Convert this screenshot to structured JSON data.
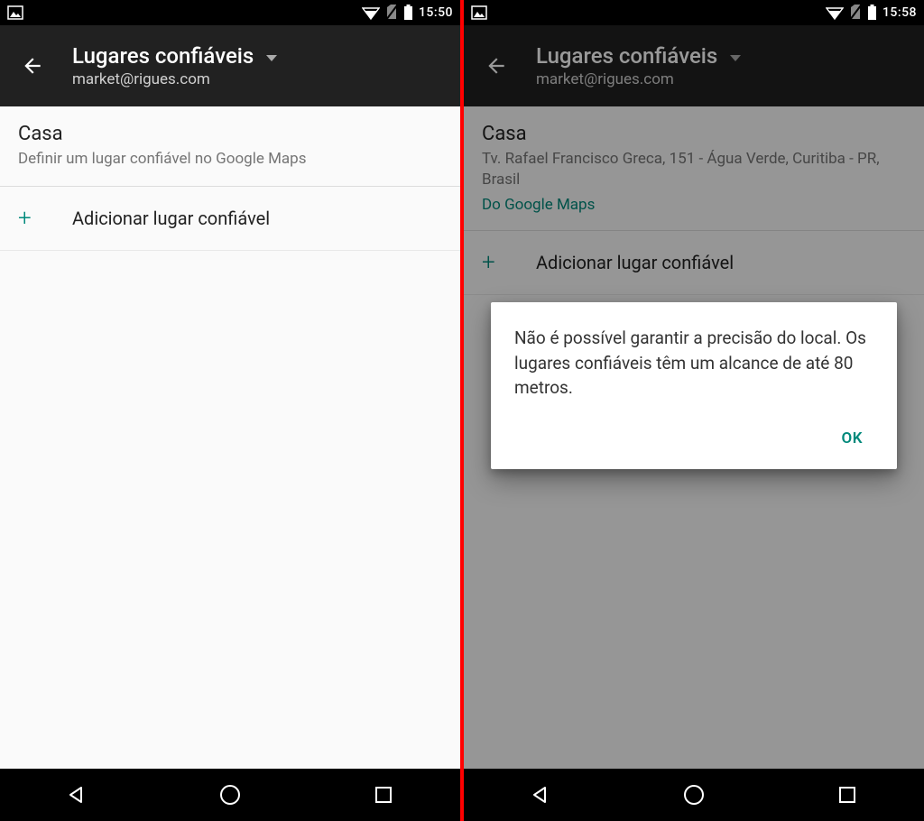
{
  "left": {
    "status_time": "15:50",
    "header_title": "Lugares confiáveis",
    "header_subtitle": "market@rigues.com",
    "place_title": "Casa",
    "place_sub": "Definir um lugar confiável no Google Maps",
    "add_label": "Adicionar lugar confiável"
  },
  "right": {
    "status_time": "15:58",
    "header_title": "Lugares confiáveis",
    "header_subtitle": "market@rigues.com",
    "place_title": "Casa",
    "place_address": "Tv. Rafael Francisco Greca, 151 - Água Verde, Curitiba - PR, Brasil",
    "place_maps": "Do Google Maps",
    "add_label": "Adicionar lugar confiável",
    "dialog_message": "Não é possível garantir a precisão do local. Os lugares confiáveis têm um alcance de até 80 metros.",
    "dialog_ok": "OK"
  },
  "colors": {
    "accent": "#00897b",
    "divider": "#ff0000"
  }
}
